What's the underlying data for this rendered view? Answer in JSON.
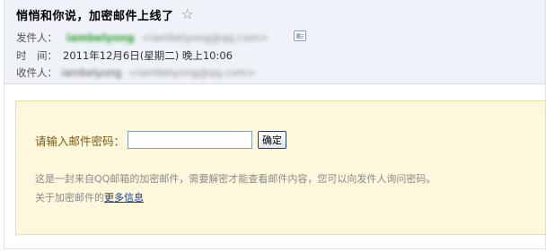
{
  "header": {
    "subject": "悄悄和你说，加密邮件上线了",
    "star_icon": "star-icon",
    "from_label": "发件人：",
    "from_name": "iambelyong",
    "from_address": "<iambelyong@qq.com>",
    "contact_icon": "contact-card-icon",
    "time_label": "时　间：",
    "time_value": "2011年12月6日(星期二) 晚上10:06",
    "to_label": "收件人：",
    "to_name": "iambelyong",
    "to_address": "<iambelyong@qq.com>"
  },
  "panel": {
    "password_label": "请输入邮件密码：",
    "password_value": "",
    "confirm_label": "确定",
    "info_text": "这是一封来自QQ邮箱的加密邮件，需要解密才能查看邮件内容，您可以向发件人询问密码。",
    "more_prefix": "关于加密邮件的",
    "more_link": "更多信息"
  },
  "colors": {
    "header_bg": "#eff3f9",
    "panel_bg": "#fdf7db",
    "panel_border": "#ecdea2",
    "link": "#1a3c8c",
    "sender_green": "#2f9e2f"
  }
}
